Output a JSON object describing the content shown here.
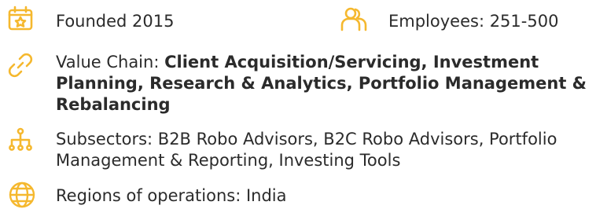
{
  "colors": {
    "icon": "#f5b82e",
    "text": "#2b2b2b"
  },
  "founded": {
    "icon": "calendar-star-icon",
    "label": "Founded 2015"
  },
  "employees": {
    "icon": "people-icon",
    "label": "Employees: 251-500"
  },
  "value_chain": {
    "icon": "link-icon",
    "prefix": "Value Chain: ",
    "items": "Client Acquisition/Servicing, Investment Planning, Research & Analytics, Portfolio Management & Rebalancing"
  },
  "subsectors": {
    "icon": "org-chart-icon",
    "label": "Subsectors: B2B Robo Advisors, B2C Robo Advisors, Portfolio Management & Reporting, Investing Tools"
  },
  "regions": {
    "icon": "globe-icon",
    "label": "Regions of operations: India"
  }
}
